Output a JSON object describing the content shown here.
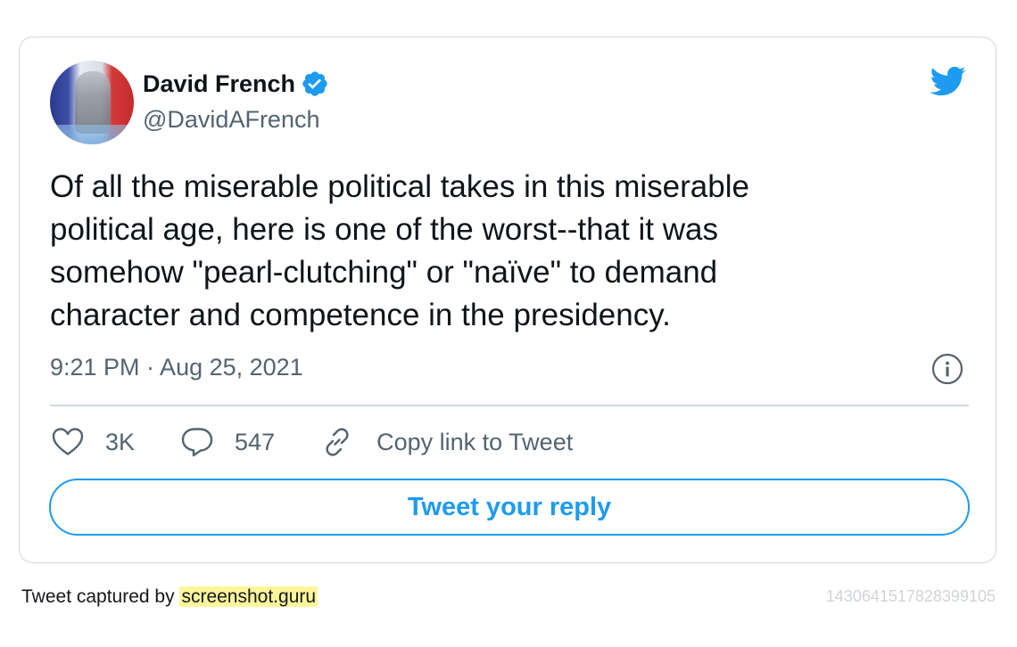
{
  "user": {
    "name": "David French",
    "handle": "@DavidAFrench",
    "verified_icon": "verified-badge-icon",
    "avatar_icon": "avatar"
  },
  "brand": {
    "icon": "twitter-bird-icon",
    "color": "#1d9bf0"
  },
  "tweet": {
    "lines": [
      "Of all the miserable political takes in this miserable",
      "political age, here is one of the worst--that it was",
      "somehow \"pearl-clutching\" or \"naïve\" to demand",
      "character and competence in the presidency."
    ],
    "timestamp": "9:21 PM · Aug 25, 2021"
  },
  "actions": {
    "like_count": "3K",
    "reply_count": "547",
    "copy_link_label": "Copy link to Tweet"
  },
  "reply_button_label": "Tweet your reply",
  "footer": {
    "captured_prefix": "Tweet captured by",
    "captured_link": "screenshot.guru",
    "tweet_id": "1430641517828399105"
  },
  "colors": {
    "text_primary": "#0f1419",
    "text_secondary": "#536471",
    "border": "#cfd9de",
    "accent": "#1d9bf0",
    "highlight": "#fff59a"
  }
}
